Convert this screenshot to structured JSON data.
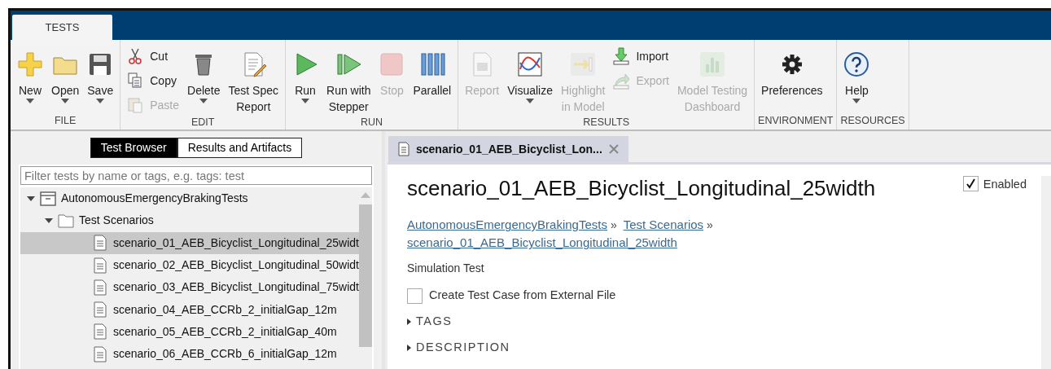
{
  "ribbon": {
    "tabs": [
      {
        "label": "TESTS",
        "selected": true
      }
    ],
    "groups": [
      {
        "label": "FILE",
        "items": [
          {
            "kind": "large",
            "label": "New",
            "disabled": false,
            "dropdown": true
          },
          {
            "kind": "large",
            "label": "Open",
            "disabled": false,
            "dropdown": true
          },
          {
            "kind": "large",
            "label": "Save",
            "disabled": false,
            "dropdown": true
          }
        ]
      },
      {
        "label": "EDIT",
        "items": [
          {
            "kind": "stack",
            "items": [
              {
                "label": "Cut",
                "disabled": false
              },
              {
                "label": "Copy",
                "disabled": false
              },
              {
                "label": "Paste",
                "disabled": true
              }
            ]
          },
          {
            "kind": "large",
            "label": "Delete",
            "disabled": false,
            "dropdown": true
          },
          {
            "kind": "large",
            "label": "Test Spec\nReport",
            "disabled": false,
            "dropdown": false
          }
        ]
      },
      {
        "label": "RUN",
        "items": [
          {
            "kind": "large",
            "label": "Run",
            "disabled": false,
            "dropdown": true
          },
          {
            "kind": "large",
            "label": "Run with\nStepper",
            "disabled": false,
            "dropdown": false
          },
          {
            "kind": "large",
            "label": "Stop",
            "disabled": true,
            "dropdown": false
          },
          {
            "kind": "large",
            "label": "Parallel",
            "disabled": false,
            "dropdown": false
          }
        ]
      },
      {
        "label": "RESULTS",
        "items": [
          {
            "kind": "large",
            "label": "Report",
            "disabled": true,
            "dropdown": false
          },
          {
            "kind": "large",
            "label": "Visualize",
            "disabled": false,
            "dropdown": true
          },
          {
            "kind": "large",
            "label": "Highlight\nin Model",
            "disabled": true,
            "dropdown": false
          },
          {
            "kind": "stack",
            "items": [
              {
                "label": "Import",
                "disabled": false
              },
              {
                "label": "Export",
                "disabled": true
              }
            ]
          },
          {
            "kind": "large",
            "label": "Model Testing\nDashboard",
            "disabled": true,
            "dropdown": false
          }
        ]
      },
      {
        "label": "ENVIRONMENT",
        "items": [
          {
            "kind": "large",
            "label": "Preferences",
            "disabled": false,
            "dropdown": false
          }
        ]
      },
      {
        "label": "RESOURCES",
        "items": [
          {
            "kind": "large",
            "label": "Help",
            "disabled": false,
            "dropdown": true
          }
        ]
      }
    ]
  },
  "browser": {
    "tabs": [
      {
        "label": "Test Browser",
        "selected": true
      },
      {
        "label": "Results and Artifacts",
        "selected": false
      }
    ],
    "filter": {
      "placeholder": "Filter tests by name or tags, e.g. tags: test"
    },
    "tree": [
      {
        "kind": "suite",
        "label": "AutonomousEmergencyBrakingTests",
        "expanded": true,
        "selected": false,
        "children": [
          {
            "kind": "folder",
            "label": "Test Scenarios",
            "expanded": true,
            "selected": false,
            "children": [
              {
                "kind": "test",
                "label": "scenario_01_AEB_Bicyclist_Longitudinal_25widt",
                "selected": true
              },
              {
                "kind": "test",
                "label": "scenario_02_AEB_Bicyclist_Longitudinal_50widt",
                "selected": false
              },
              {
                "kind": "test",
                "label": "scenario_03_AEB_Bicyclist_Longitudinal_75widt",
                "selected": false
              },
              {
                "kind": "test",
                "label": "scenario_04_AEB_CCRb_2_initialGap_12m",
                "selected": false
              },
              {
                "kind": "test",
                "label": "scenario_05_AEB_CCRb_2_initialGap_40m",
                "selected": false
              },
              {
                "kind": "test",
                "label": "scenario_06_AEB_CCRb_6_initialGap_12m",
                "selected": false
              }
            ]
          }
        ]
      }
    ]
  },
  "editor": {
    "tabs": [
      {
        "label": "scenario_01_AEB_Bicyclist_Lon...",
        "selected": true
      }
    ],
    "title": "scenario_01_AEB_Bicyclist_Longitudinal_25width",
    "enabled": {
      "label": "Enabled",
      "checked": true
    },
    "breadcrumb": [
      {
        "label": "AutonomousEmergencyBrakingTests",
        "separator": "»"
      },
      {
        "label": "Test Scenarios",
        "separator": "»"
      },
      {
        "label": "scenario_01_AEB_Bicyclist_Longitudinal_25width"
      }
    ],
    "type": "Simulation Test",
    "external": {
      "label": "Create Test Case from External File",
      "checked": false
    },
    "sections": [
      {
        "label": "TAGS",
        "expanded": false
      },
      {
        "label": "DESCRIPTION",
        "expanded": false
      }
    ]
  }
}
